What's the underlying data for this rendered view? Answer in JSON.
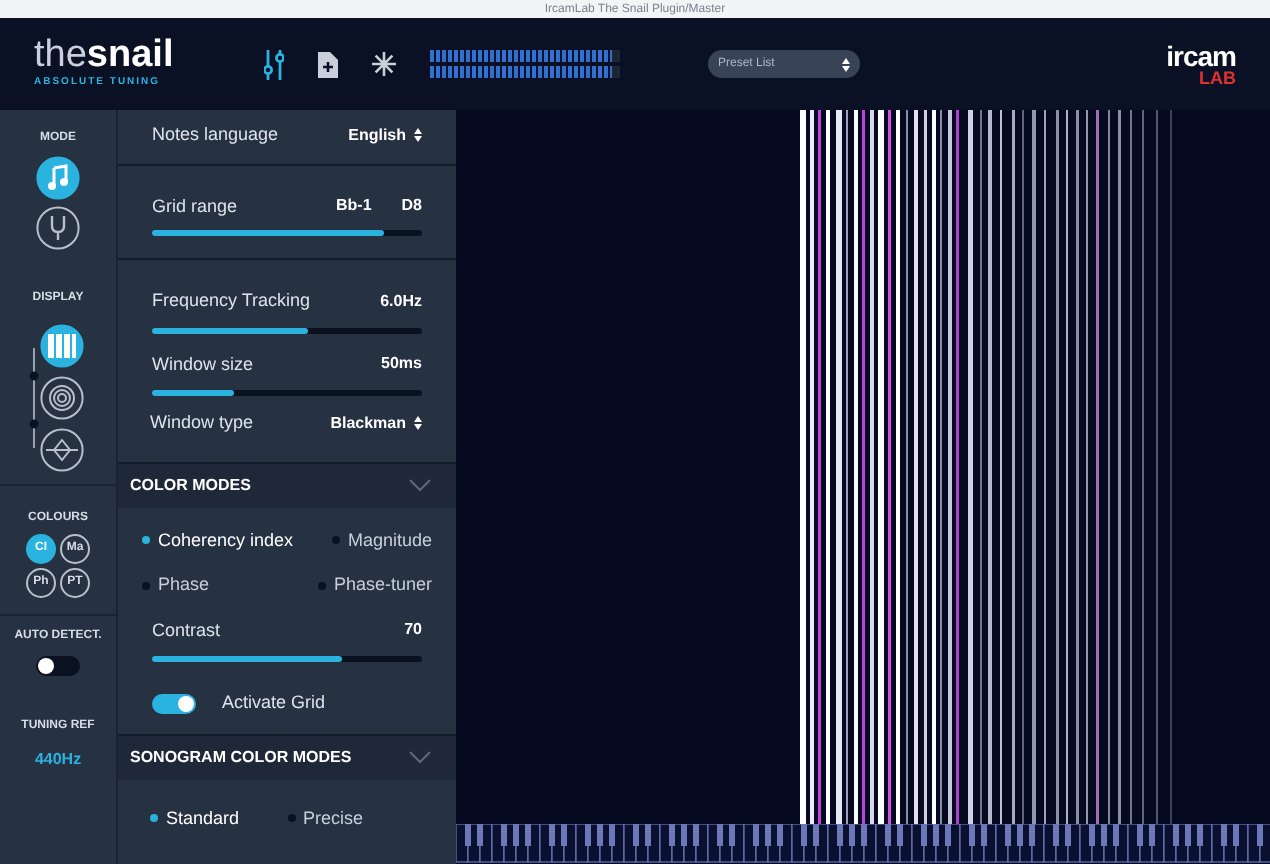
{
  "window": {
    "title": "IrcamLab The Snail Plugin/Master"
  },
  "header": {
    "logo": {
      "name_light": "the",
      "name_bold": "snail",
      "tagline": "ABSOLUTE TUNING"
    },
    "meter": [
      {
        "level": 0.96
      },
      {
        "level": 0.96
      }
    ],
    "preset": {
      "value": "Preset List"
    },
    "brand": {
      "top": "ircam",
      "bottom": "LAB"
    }
  },
  "sidebar": {
    "mode": {
      "label": "MODE",
      "items": [
        {
          "kind": "note",
          "selected": true
        },
        {
          "kind": "fork",
          "selected": false
        }
      ]
    },
    "display": {
      "label": "DISPLAY",
      "items": [
        {
          "kind": "piano",
          "selected": true
        },
        {
          "kind": "spiral",
          "selected": false
        },
        {
          "kind": "diamond",
          "selected": false
        }
      ]
    },
    "colours": {
      "label": "COLOURS",
      "items": [
        {
          "label": "CI",
          "selected": true
        },
        {
          "label": "Ma",
          "selected": false
        },
        {
          "label": "Ph",
          "selected": false
        },
        {
          "label": "PT",
          "selected": false
        }
      ]
    },
    "auto_detect": {
      "label": "AUTO DETECT.",
      "on": false
    },
    "tuning_ref": {
      "label": "TUNING REF",
      "value": "440Hz"
    }
  },
  "settings": {
    "notes_language": {
      "label": "Notes language",
      "value": "English"
    },
    "grid_range": {
      "label": "Grid range",
      "low": "Bb-1",
      "high": "D8",
      "level": 0.86
    },
    "frequency_tracking": {
      "label": "Frequency Tracking",
      "value": "6.0Hz",
      "level": 0.58
    },
    "window_size": {
      "label": "Window size",
      "value": "50ms",
      "level": 0.3
    },
    "window_type": {
      "label": "Window type",
      "value": "Blackman"
    },
    "color_modes": {
      "title": "COLOR MODES",
      "expanded": true,
      "options": [
        {
          "label": "Coherency index",
          "selected": true
        },
        {
          "label": "Magnitude",
          "selected": false
        },
        {
          "label": "Phase",
          "selected": false
        },
        {
          "label": "Phase-tuner",
          "selected": false
        }
      ],
      "contrast": {
        "label": "Contrast",
        "value": "70",
        "level": 0.7
      },
      "activate_grid": {
        "label": "Activate Grid",
        "on": true
      }
    },
    "sonogram_color_modes": {
      "title": "SONOGRAM COLOR MODES",
      "expanded": true,
      "options": [
        {
          "label": "Standard",
          "selected": true
        },
        {
          "label": "Precise",
          "selected": false
        }
      ]
    }
  }
}
